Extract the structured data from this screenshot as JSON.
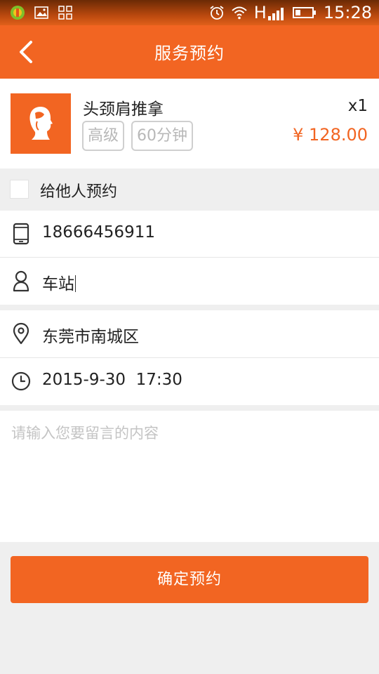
{
  "status_bar": {
    "time": "15:28",
    "network": "H"
  },
  "nav": {
    "title": "服务预约"
  },
  "service": {
    "name": "头颈肩推拿",
    "tags": [
      "高级",
      "60分钟"
    ],
    "quantity": "x1",
    "price": "¥ 128.00"
  },
  "booking": {
    "for_others_label": "给他人预约",
    "for_others_checked": false,
    "phone": "18666456911",
    "contact": "车站",
    "address": "东莞市南城区",
    "datetime": "2015-9-30  17:30",
    "message_placeholder": "请输入您要留言的内容",
    "confirm_label": "确定预约"
  },
  "colors": {
    "accent": "#f26522",
    "background": "#efefef"
  }
}
